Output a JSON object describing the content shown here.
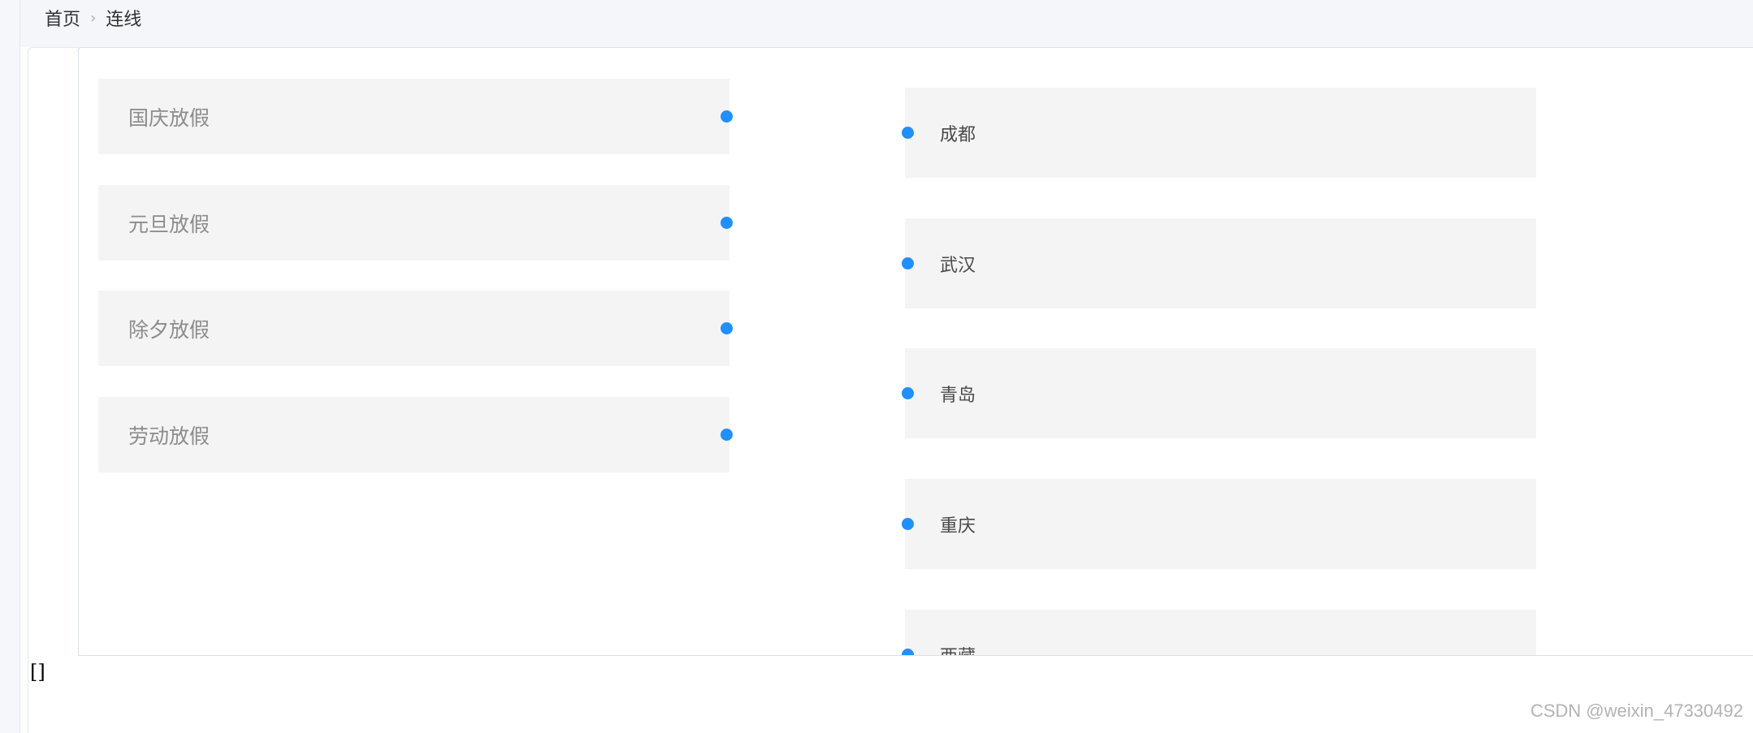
{
  "breadcrumb": {
    "home": "首页",
    "current": "连线"
  },
  "left_items": [
    {
      "label": "国庆放假"
    },
    {
      "label": "元旦放假"
    },
    {
      "label": "除夕放假"
    },
    {
      "label": "劳动放假"
    }
  ],
  "right_items": [
    {
      "label": "成都"
    },
    {
      "label": "武汉"
    },
    {
      "label": "青岛"
    },
    {
      "label": "重庆"
    },
    {
      "label": "西藏"
    }
  ],
  "output_text": "[]",
  "watermark": "CSDN @weixin_47330492",
  "colors": {
    "dot": "#1e90ff",
    "item_bg": "#f4f4f4",
    "topbar_bg": "#f4f6f9"
  }
}
